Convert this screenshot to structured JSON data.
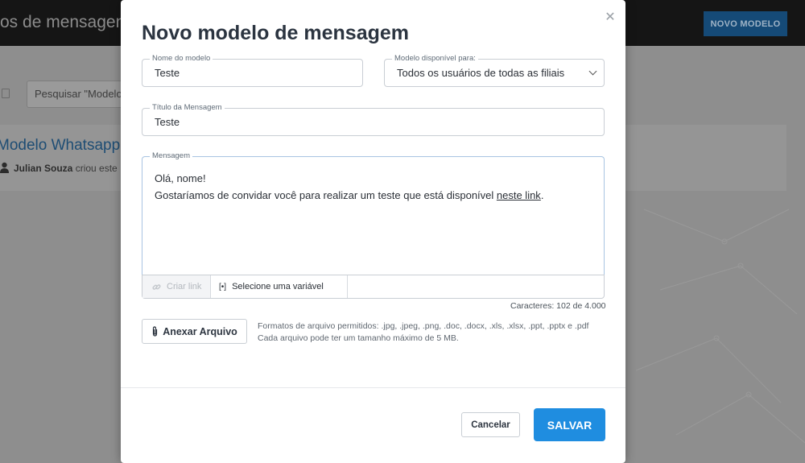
{
  "background": {
    "page_title": "os de mensagens",
    "new_model_button": "NOVO MODELO",
    "search_value": "Pesquisar \"Modelos",
    "card_title": "Modelo Whatsapp",
    "card_author": "Julian Souza",
    "card_action": "criou este"
  },
  "modal": {
    "title": "Novo modelo de mensagem",
    "close_symbol": "✕",
    "model_name": {
      "label": "Nome do modelo",
      "value": "Teste"
    },
    "availability": {
      "label": "Modelo disponível para:",
      "value": "Todos os usuários de todas as filiais"
    },
    "message_title": {
      "label": "Título da Mensagem",
      "value": "Teste"
    },
    "message": {
      "label": "Mensagem",
      "line1": "Olá, nome!",
      "line2_prefix": "Gostaríamos de convidar você para realizar um teste que está disponível ",
      "link_text": "neste link",
      "line2_suffix": "."
    },
    "toolbar": {
      "create_link": "Criar link",
      "variable_icon": "[•]",
      "select_variable": "Selecione uma variável"
    },
    "char_count": "Caracteres: 102 de 4.000",
    "attach_button": "Anexar Arquivo",
    "attach_info_line1": "Formatos de arquivo permitidos: .jpg, .jpeg, .png, .doc, .docx, .xls, .xlsx, .ppt, .pptx e .pdf",
    "attach_info_line2": "Cada arquivo pode ter um tamanho máximo de 5 MB.",
    "cancel_button": "Cancelar",
    "save_button": "SALVAR"
  },
  "colors": {
    "primary": "#1f8de0",
    "title_text": "#2b3440",
    "border": "#c9ced4",
    "focus_border": "#a8c4e2"
  }
}
